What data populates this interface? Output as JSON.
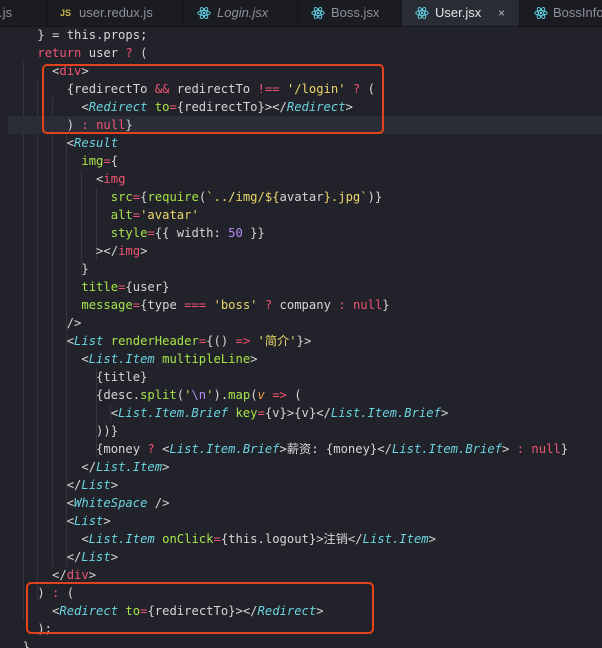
{
  "tabs": [
    {
      "label": ".js",
      "icon": "js-icon",
      "italic": false,
      "active": false
    },
    {
      "label": "user.redux.js",
      "icon": "js-icon",
      "icon_text": "JS",
      "italic": false,
      "active": false
    },
    {
      "label": "Login.jsx",
      "icon": "react-icon",
      "italic": true,
      "active": false
    },
    {
      "label": "Boss.jsx",
      "icon": "react-icon",
      "italic": false,
      "active": false
    },
    {
      "label": "User.jsx",
      "icon": "react-icon",
      "italic": false,
      "active": true,
      "close": "×"
    },
    {
      "label": "BossInfo",
      "icon": "react-icon",
      "italic": false,
      "active": false
    }
  ],
  "colors": {
    "background": "#22232a",
    "keyword": "#ef5472",
    "component": "#6ad3e0",
    "attribute": "#a6e34a",
    "string": "#ecd76b",
    "number": "#b58bf3",
    "highlight_box": "#e4421c"
  },
  "code_lines": [
    [
      [
        "p",
        "    } = this.props;"
      ]
    ],
    [
      [
        "p",
        "    "
      ],
      [
        "kw",
        "return"
      ],
      [
        "p",
        " user "
      ],
      [
        "op",
        "?"
      ],
      [
        "p",
        " ("
      ]
    ],
    [
      [
        "p",
        "      <"
      ],
      [
        "tag",
        "div"
      ],
      [
        "p",
        ">"
      ]
    ],
    [
      [
        "p",
        "        {redirectTo "
      ],
      [
        "op",
        "&&"
      ],
      [
        "p",
        " redirectTo "
      ],
      [
        "op",
        "!=="
      ],
      [
        "p",
        " "
      ],
      [
        "str",
        "'/login'"
      ],
      [
        "p",
        " "
      ],
      [
        "op",
        "?"
      ],
      [
        "p",
        " ("
      ]
    ],
    [
      [
        "p",
        "          <"
      ],
      [
        "comp",
        "Redirect"
      ],
      [
        "p",
        " "
      ],
      [
        "attr",
        "to"
      ],
      [
        "op",
        "="
      ],
      [
        "p",
        "{redirectTo}></"
      ],
      [
        "comp",
        "Redirect"
      ],
      [
        "p",
        ">"
      ]
    ],
    [
      [
        "p",
        "        ) "
      ],
      [
        "op",
        ":"
      ],
      [
        "p",
        " "
      ],
      [
        "kw",
        "null"
      ],
      [
        "p",
        "}"
      ]
    ],
    [
      [
        "p",
        "        <"
      ],
      [
        "comp",
        "Result"
      ]
    ],
    [
      [
        "p",
        "          "
      ],
      [
        "attr",
        "img"
      ],
      [
        "op",
        "="
      ],
      [
        "p",
        "{"
      ]
    ],
    [
      [
        "p",
        "            <"
      ],
      [
        "tag",
        "img"
      ]
    ],
    [
      [
        "p",
        "              "
      ],
      [
        "attr",
        "src"
      ],
      [
        "op",
        "="
      ],
      [
        "p",
        "{"
      ],
      [
        "fn",
        "require"
      ],
      [
        "p",
        "("
      ],
      [
        "tpl",
        "`../img/${"
      ],
      [
        "p",
        "avatar"
      ],
      [
        "tpl",
        "}.jpg`"
      ],
      [
        "p",
        ")}"
      ]
    ],
    [
      [
        "p",
        "              "
      ],
      [
        "attr",
        "alt"
      ],
      [
        "op",
        "="
      ],
      [
        "str",
        "'avatar'"
      ]
    ],
    [
      [
        "p",
        "              "
      ],
      [
        "attr",
        "style"
      ],
      [
        "op",
        "="
      ],
      [
        "p",
        "{{ width: "
      ],
      [
        "num",
        "50"
      ],
      [
        "p",
        " }}"
      ]
    ],
    [
      [
        "p",
        "            ></"
      ],
      [
        "tag",
        "img"
      ],
      [
        "p",
        ">"
      ]
    ],
    [
      [
        "p",
        "          }"
      ]
    ],
    [
      [
        "p",
        "          "
      ],
      [
        "attr",
        "title"
      ],
      [
        "op",
        "="
      ],
      [
        "p",
        "{user}"
      ]
    ],
    [
      [
        "p",
        "          "
      ],
      [
        "attr",
        "message"
      ],
      [
        "op",
        "="
      ],
      [
        "p",
        "{type "
      ],
      [
        "op",
        "==="
      ],
      [
        "p",
        " "
      ],
      [
        "str",
        "'boss'"
      ],
      [
        "p",
        " "
      ],
      [
        "op",
        "?"
      ],
      [
        "p",
        " company "
      ],
      [
        "op",
        ":"
      ],
      [
        "p",
        " "
      ],
      [
        "kw",
        "null"
      ],
      [
        "p",
        "}"
      ]
    ],
    [
      [
        "p",
        "        />"
      ]
    ],
    [
      [
        "p",
        "        <"
      ],
      [
        "comp",
        "List"
      ],
      [
        "p",
        " "
      ],
      [
        "attr",
        "renderHeader"
      ],
      [
        "op",
        "="
      ],
      [
        "p",
        "{() "
      ],
      [
        "op",
        "=>"
      ],
      [
        "p",
        " "
      ],
      [
        "str",
        "'简介'"
      ],
      [
        "p",
        "}>"
      ]
    ],
    [
      [
        "p",
        "          <"
      ],
      [
        "comp",
        "List.Item"
      ],
      [
        "p",
        " "
      ],
      [
        "attr",
        "multipleLine"
      ],
      [
        "p",
        ">"
      ]
    ],
    [
      [
        "p",
        "            {title}"
      ]
    ],
    [
      [
        "p",
        "            {desc."
      ],
      [
        "fn",
        "split"
      ],
      [
        "p",
        "("
      ],
      [
        "str",
        "'"
      ],
      [
        "esc",
        "\\n"
      ],
      [
        "str",
        "'"
      ],
      [
        "p",
        ")."
      ],
      [
        "fn",
        "map"
      ],
      [
        "p",
        "("
      ],
      [
        "var",
        "v"
      ],
      [
        "p",
        " "
      ],
      [
        "op",
        "=>"
      ],
      [
        "p",
        " ("
      ]
    ],
    [
      [
        "p",
        "              <"
      ],
      [
        "comp",
        "List.Item.Brief"
      ],
      [
        "p",
        " "
      ],
      [
        "attr",
        "key"
      ],
      [
        "op",
        "="
      ],
      [
        "p",
        "{v}>{v}</"
      ],
      [
        "comp",
        "List.Item.Brief"
      ],
      [
        "p",
        ">"
      ]
    ],
    [
      [
        "p",
        "            ))}"
      ]
    ],
    [
      [
        "p",
        "            {money "
      ],
      [
        "op",
        "?"
      ],
      [
        "p",
        " <"
      ],
      [
        "comp",
        "List.Item.Brief"
      ],
      [
        "p",
        ">薪资: {money}</"
      ],
      [
        "comp",
        "List.Item.Brief"
      ],
      [
        "p",
        "> "
      ],
      [
        "op",
        ":"
      ],
      [
        "p",
        " "
      ],
      [
        "kw",
        "null"
      ],
      [
        "p",
        "}"
      ]
    ],
    [
      [
        "p",
        "          </"
      ],
      [
        "comp",
        "List.Item"
      ],
      [
        "p",
        ">"
      ]
    ],
    [
      [
        "p",
        "        </"
      ],
      [
        "comp",
        "List"
      ],
      [
        "p",
        ">"
      ]
    ],
    [
      [
        "p",
        "        <"
      ],
      [
        "comp",
        "WhiteSpace"
      ],
      [
        "p",
        " />"
      ]
    ],
    [
      [
        "p",
        "        <"
      ],
      [
        "comp",
        "List"
      ],
      [
        "p",
        ">"
      ]
    ],
    [
      [
        "p",
        "          <"
      ],
      [
        "comp",
        "List.Item"
      ],
      [
        "p",
        " "
      ],
      [
        "attr",
        "onClick"
      ],
      [
        "op",
        "="
      ],
      [
        "p",
        "{this.logout}>注销</"
      ],
      [
        "comp",
        "List.Item"
      ],
      [
        "p",
        ">"
      ]
    ],
    [
      [
        "p",
        "        </"
      ],
      [
        "comp",
        "List"
      ],
      [
        "p",
        ">"
      ]
    ],
    [
      [
        "p",
        "      </"
      ],
      [
        "tag",
        "div"
      ],
      [
        "p",
        ">"
      ]
    ],
    [
      [
        "p",
        "    ) "
      ],
      [
        "op",
        ":"
      ],
      [
        "p",
        " ("
      ]
    ],
    [
      [
        "p",
        "      <"
      ],
      [
        "comp",
        "Redirect"
      ],
      [
        "p",
        " "
      ],
      [
        "attr",
        "to"
      ],
      [
        "op",
        "="
      ],
      [
        "p",
        "{redirectTo}></"
      ],
      [
        "comp",
        "Redirect"
      ],
      [
        "p",
        ">"
      ]
    ],
    [
      [
        "p",
        "    );"
      ]
    ],
    [
      [
        "p",
        "  }"
      ]
    ]
  ]
}
